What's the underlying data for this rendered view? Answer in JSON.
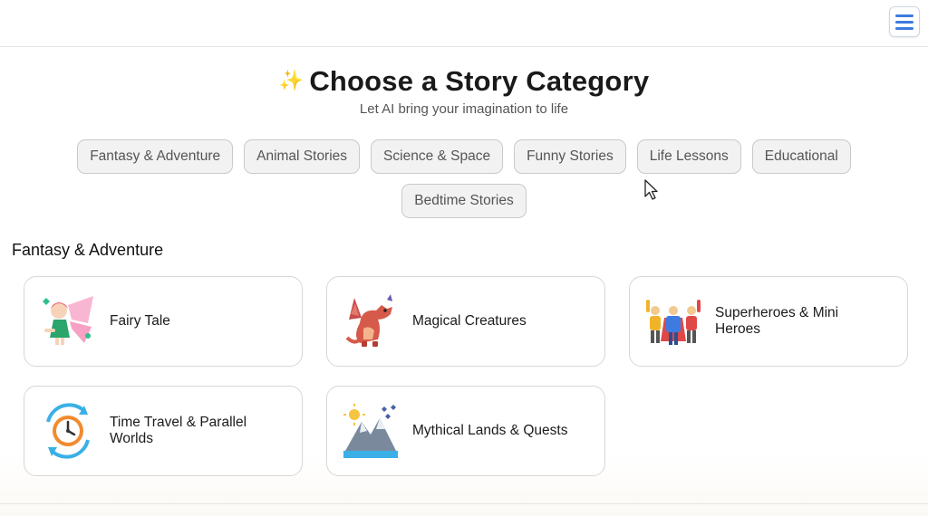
{
  "header": {
    "title": "Choose a Story Category",
    "subtitle": "Let AI bring your imagination to life",
    "menu_icon": "hamburger-menu-icon",
    "sparkle_icon": "sparkle-icon"
  },
  "categories": [
    {
      "label": "Fantasy & Adventure"
    },
    {
      "label": "Animal Stories"
    },
    {
      "label": "Science & Space"
    },
    {
      "label": "Funny Stories"
    },
    {
      "label": "Life Lessons"
    },
    {
      "label": "Educational"
    },
    {
      "label": "Bedtime Stories"
    }
  ],
  "section": {
    "title": "Fantasy & Adventure",
    "cards": [
      {
        "label": "Fairy Tale",
        "icon": "fairy-icon"
      },
      {
        "label": "Magical Creatures",
        "icon": "dragon-icon"
      },
      {
        "label": "Superheroes & Mini Heroes",
        "icon": "superheroes-icon"
      },
      {
        "label": "Time Travel & Parallel Worlds",
        "icon": "clock-cycle-icon"
      },
      {
        "label": "Mythical Lands & Quests",
        "icon": "mountain-landscape-icon"
      }
    ]
  },
  "colors": {
    "menu_accent": "#3d7be0",
    "pill_bg": "#f2f2f2",
    "sparkle": "#f1c232"
  }
}
